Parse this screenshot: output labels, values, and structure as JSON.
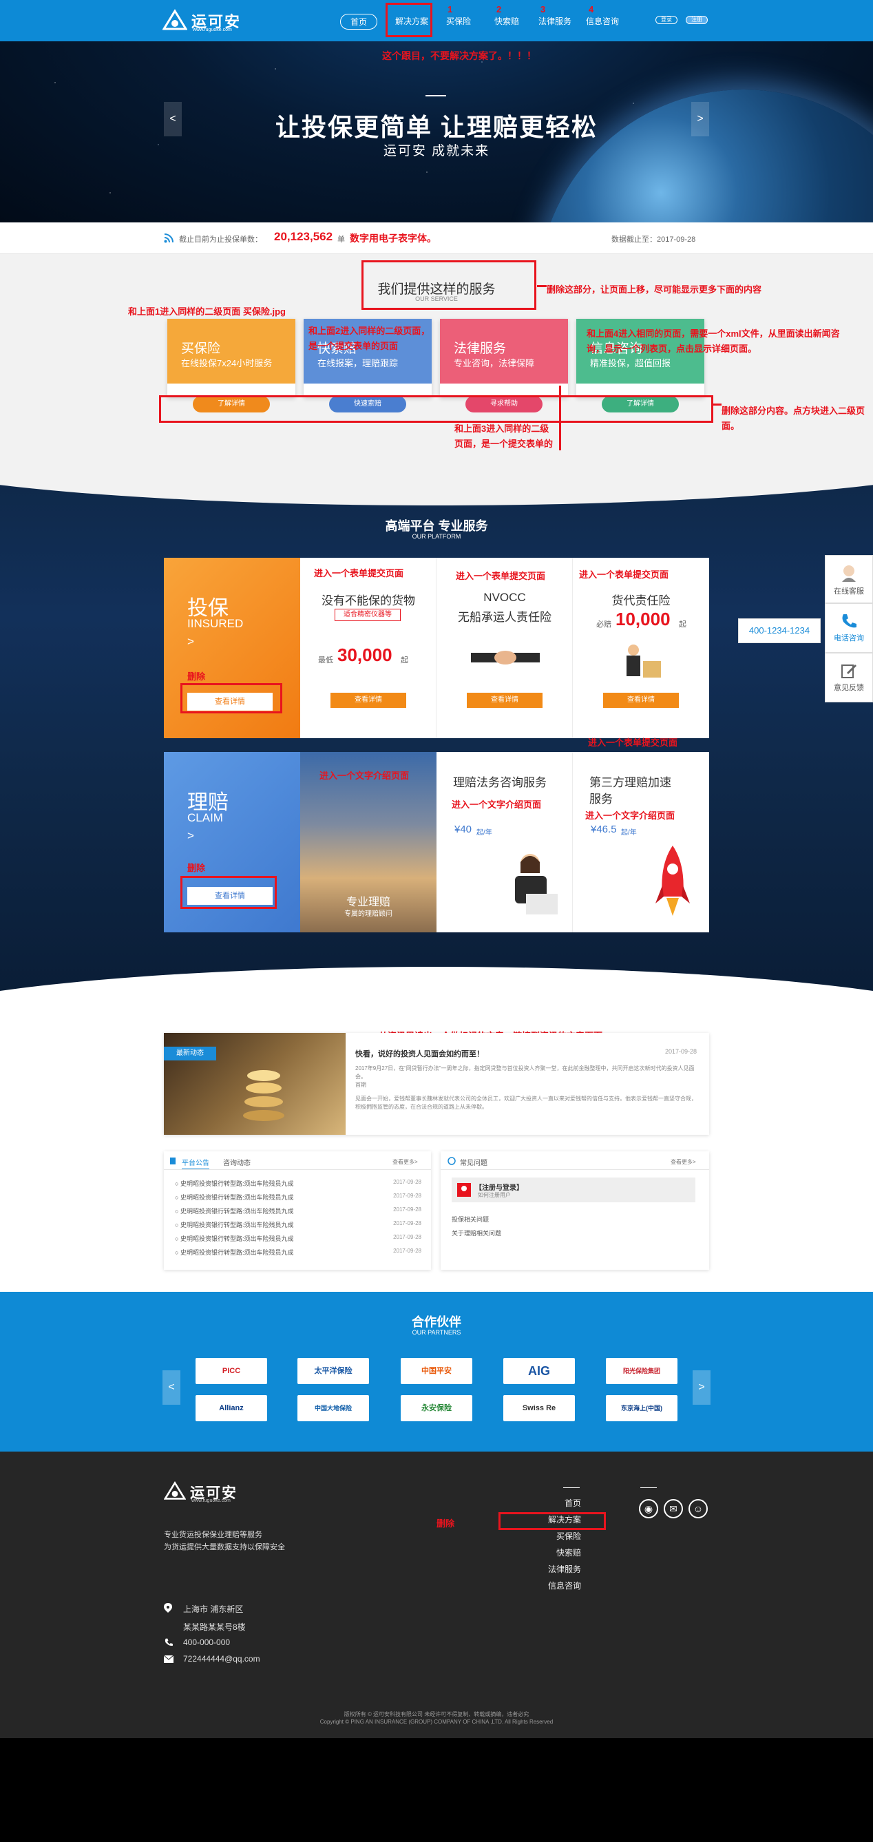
{
  "header": {
    "logo_text": "运可安",
    "logo_url": "www.fuguoke.com",
    "nav": [
      "首页",
      "解决方案",
      "买保险",
      "快索赔",
      "法律服务",
      "信息咨询"
    ],
    "nav_nums": [
      "1",
      "2",
      "3",
      "4"
    ],
    "login": "登录",
    "register": "注册"
  },
  "banner": {
    "title": "让投保更简单  让理赔更轻松",
    "subtitle": "运可安  成就未来",
    "prev": "<",
    "next": ">"
  },
  "stats": {
    "label": "截止目前为止投保单数：",
    "count": "20,123,562",
    "unit": "单",
    "note": "数字用电子表字体。",
    "date_text": "数据截止至：2017-09-28"
  },
  "service": {
    "title": "我们提供这样的服务",
    "subtitle": "OUR SERVICE",
    "cards": [
      {
        "title": "买保险",
        "desc": "在线投保7x24小时服务",
        "btn": "了解详情",
        "color": "#f5a83a",
        "btn_color": "#f08a1c"
      },
      {
        "title": "快索赔",
        "desc": "在线报案，理赔跟踪",
        "btn": "快速索赔",
        "color": "#5d8fd8",
        "btn_color": "#4a7ed0"
      },
      {
        "title": "法律服务",
        "desc": "专业咨询，法律保障",
        "btn": "寻求帮助",
        "color": "#ec5f78",
        "btn_color": "#e4476a"
      },
      {
        "title": "信息咨询",
        "desc": "精准投保，超值回报",
        "btn": "了解详情",
        "color": "#4dbc8e",
        "btn_color": "#3daf7f"
      }
    ]
  },
  "platform": {
    "title": "高端平台  专业服务",
    "subtitle": "OUR PLATFORM",
    "insure": {
      "title": "投保",
      "en": "IINSURED",
      "arrow": ">",
      "btn": "查看详情",
      "items": [
        {
          "name": "没有不能保的货物",
          "tag": "适合精密仪器等",
          "prefix": "最低",
          "price": "30,000",
          "suffix": "起",
          "btn": "查看详情"
        },
        {
          "name": "NVOCC",
          "name2": "无船承运人责任险",
          "btn": "查看详情"
        },
        {
          "name": "货代责任险",
          "prefix": "必赔",
          "price": "10,000",
          "suffix": "起",
          "btn": "查看详情"
        }
      ]
    },
    "claim": {
      "title": "理赔",
      "en": "CLAIM",
      "arrow": ">",
      "btn": "查看详情",
      "items": [
        {
          "caption": "专业理赔",
          "caption2": "专属的理赔顾问"
        },
        {
          "name": "理赔法务咨询服务",
          "price": "¥40",
          "unit": "起/年"
        },
        {
          "name": "第三方理赔加速",
          "name2": "服务",
          "price": "¥46.5",
          "unit": "起/年"
        }
      ]
    }
  },
  "news": {
    "badge": "最新动态",
    "headline": "快看，说好的投资人见面会如约而至！",
    "date": "2017-09-28",
    "para1": "2017年9月27日，在“网贷暂行办法”一周年之际，指定网贷整与首位投资人齐聚一堂，在此前金融整理中，共同开启这次新时代的投资人见面会。",
    "para1_tail": "首期",
    "para2": "见面会一开始，爱钱帮董事长魏林发就代表公司的全体员工，欢迎广大投资人一直以来对爱钱帮的信任与支持。他表示爱钱帮一直坚守合规，积极拥抱监管的态度，在合法合规的道路上从未停歇。",
    "tabs": [
      "平台公告",
      "咨询动态"
    ],
    "more": "查看更多>",
    "list_item": "史明昭投资银行转型路:须出车险残员九成",
    "list_date": "2017-09-28",
    "faq_title": "常见问题",
    "faq_badge": "【注册与登录】",
    "faq_badge2": "如何注册用户",
    "faq_items": [
      "投保相关问题",
      "关于理赔相关问题"
    ]
  },
  "partners": {
    "title": "合作伙伴",
    "subtitle": "OUR PARTNERS",
    "row1": [
      "PICC",
      "太平洋保险",
      "中国平安",
      "AIG",
      "阳光保险集团"
    ],
    "row2": [
      "Allianz",
      "中国大地保险",
      "永安保险",
      "Swiss Re",
      "东京海上(中国)"
    ]
  },
  "footer": {
    "logo_text": "运可安",
    "logo_url": "www.fuguoke.com",
    "slogan1": "专业货运投保保业理赔等服务",
    "slogan2": "为货运提供大量数据支持以保障安全",
    "links": [
      "首页",
      "解决方案",
      "买保险",
      "快索赔",
      "法律服务",
      "信息咨询"
    ],
    "address1": "上海市  浦东新区",
    "address2": "某某路某某号8楼",
    "phone": "400-000-000",
    "email": "722444444@qq.com",
    "copyright1": "版权所有 © 运可安科技有限公司 未经许可不得复制、转载或摘编，违者必究",
    "copyright2": "Copyright © PING AN INSURANCE (GROUP) COMPANY OF CHINA ,LTD. All Rights Reserved"
  },
  "side": {
    "service": "在线客服",
    "phone_label": "电话咨询",
    "phone_number": "400-1234-1234",
    "feedback": "意见反馈"
  },
  "annotations": {
    "n_top": "这个跟目，不要解决方案了。！！！",
    "n_remove_top": "删除这部分，让页面上移，尽可能显示更多下面的内容",
    "n_left": "和上面1进入同样的二级页面 买保险.jpg",
    "n_card2": "和上面2进入同样的二级页面，是一个提交表单的页面",
    "n_card4": "和上面4进入相同的页面，需要一个xml文件，从里面读出新闻咨询，显示一个列表页，点击显示详细页面。",
    "n_card3": "和上面3进入同样的二级页面，是一个提交表单的页面。",
    "n_remove_btns": "删除这部分内容。点方块进入二级页面。",
    "n_form1": "进入一个表单提交页面",
    "n_form2": "进入一个表单提交页面",
    "n_form3": "进入一个表单提交页面",
    "n_form4": "进入一个表单提交页面",
    "n_del1": "删除",
    "n_del2": "删除",
    "n_text1": "进入一个文字介绍页面",
    "n_text2": "进入一个文字介绍页面",
    "n_text3": "进入一个文字介绍页面",
    "n_news": "从资讯里读出一个做标记的文章，链接到资讯的文章页面",
    "n_del_footer": "删除"
  }
}
